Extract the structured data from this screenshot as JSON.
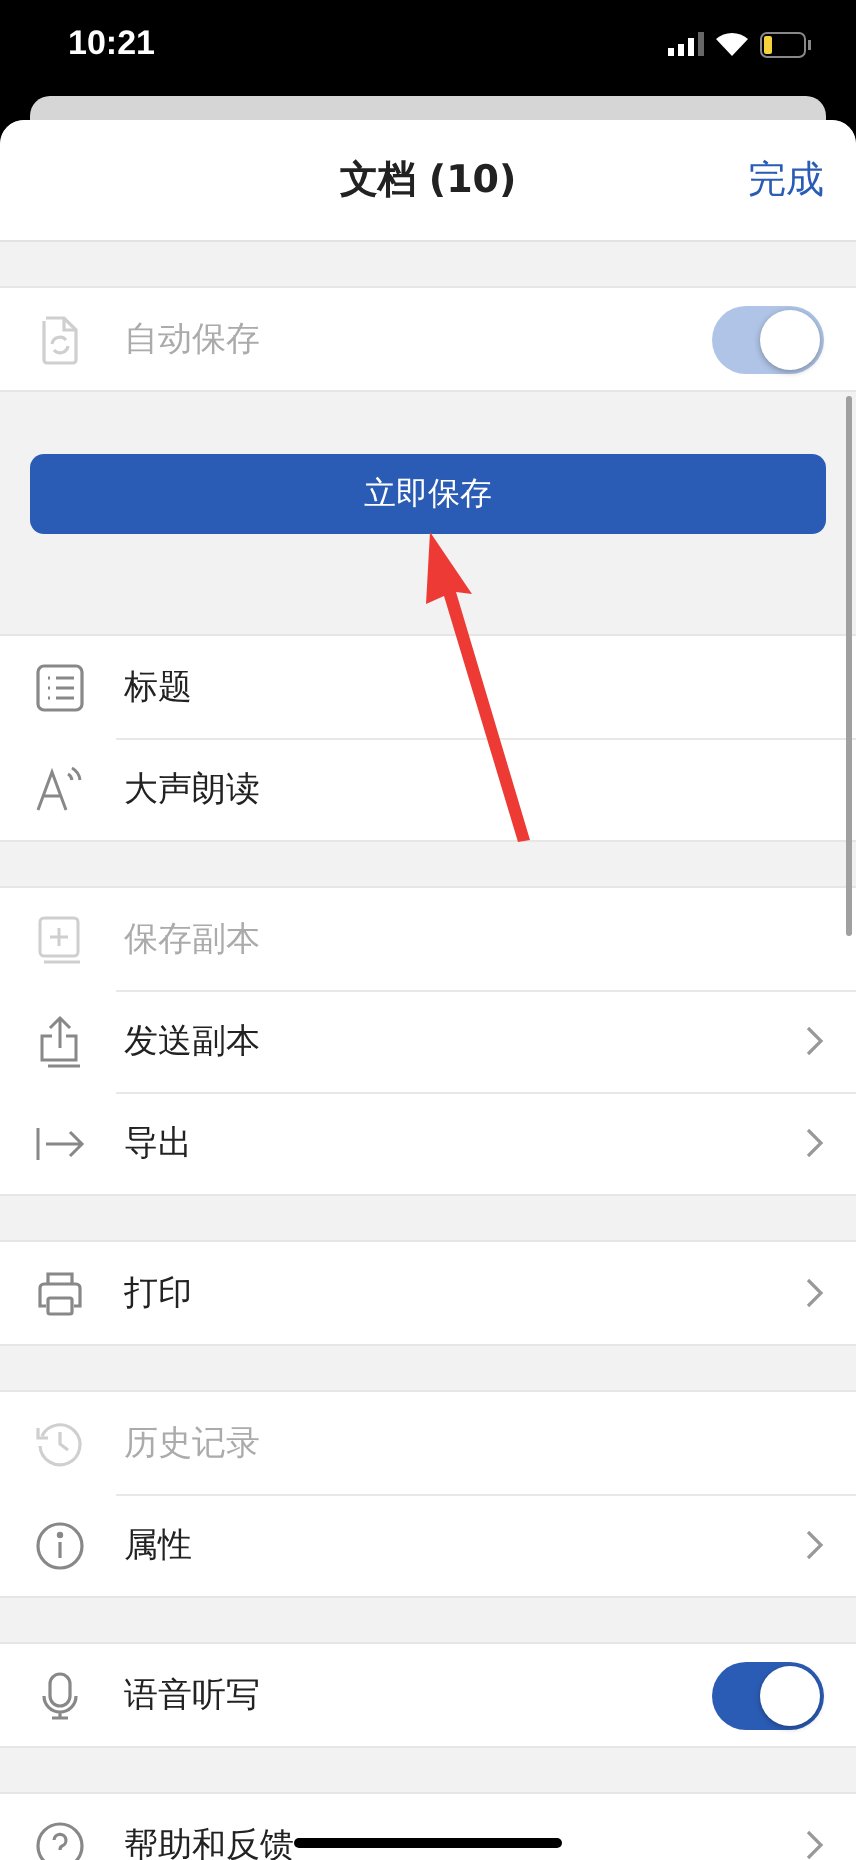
{
  "status_bar": {
    "time": "10:21"
  },
  "sheet": {
    "title": "文档 (10)",
    "done_button": "完成"
  },
  "sections": [
    {
      "kind": "list",
      "items": [
        {
          "kind": "toggle",
          "label": "自动保存",
          "disabled": true,
          "on": true
        }
      ]
    },
    {
      "kind": "button",
      "label": "立即保存"
    },
    {
      "kind": "list",
      "items": [
        {
          "kind": "plain",
          "label": "标题",
          "disabled": false
        },
        {
          "kind": "plain",
          "label": "大声朗读",
          "disabled": false
        }
      ]
    },
    {
      "kind": "list",
      "items": [
        {
          "kind": "plain",
          "label": "保存副本",
          "disabled": true
        },
        {
          "kind": "link",
          "label": "发送副本",
          "disabled": false
        },
        {
          "kind": "link",
          "label": "导出",
          "disabled": false
        }
      ]
    },
    {
      "kind": "list",
      "items": [
        {
          "kind": "link",
          "label": "打印",
          "disabled": false
        }
      ]
    },
    {
      "kind": "list",
      "items": [
        {
          "kind": "plain",
          "label": "历史记录",
          "disabled": true
        },
        {
          "kind": "link",
          "label": "属性",
          "disabled": false
        }
      ]
    },
    {
      "kind": "list",
      "items": [
        {
          "kind": "toggle",
          "label": "语音听写",
          "disabled": false,
          "on": true
        }
      ]
    },
    {
      "kind": "list",
      "items": [
        {
          "kind": "link",
          "label": "帮助和反馈",
          "disabled": false
        }
      ]
    }
  ],
  "annotations": [
    {
      "kind": "arrow"
    }
  ]
}
